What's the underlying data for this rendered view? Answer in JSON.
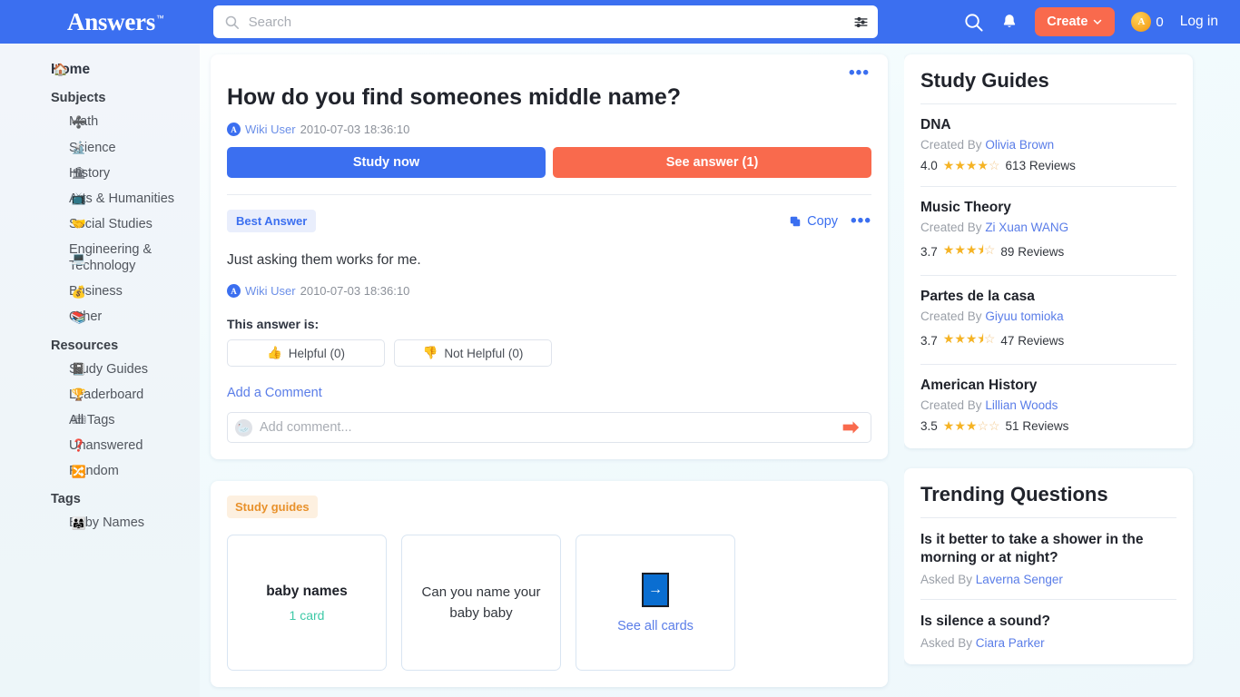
{
  "header": {
    "logo": "Answers",
    "logo_tm": "™",
    "search_placeholder": "Search",
    "search_value": "",
    "create_label": "Create",
    "coin_letter": "A",
    "coin_count": "0",
    "login_label": "Log in",
    "accent_blue": "#3B6FF0",
    "accent_orange": "#F96A4D"
  },
  "sidebar": {
    "home": {
      "label": "Home",
      "icon": "🏠"
    },
    "subjects_heading": "Subjects",
    "subjects": [
      {
        "label": "Math",
        "icon": "➗"
      },
      {
        "label": "Science",
        "icon": "🔬"
      },
      {
        "label": "History",
        "icon": "🏛"
      },
      {
        "label": "Arts & Humanities",
        "icon": "📺"
      },
      {
        "label": "Social Studies",
        "icon": "🤝"
      },
      {
        "label": "Engineering & Technology",
        "icon": "💻"
      },
      {
        "label": "Business",
        "icon": "💰"
      },
      {
        "label": "Other",
        "icon": "📚"
      }
    ],
    "resources_heading": "Resources",
    "resources": [
      {
        "label": "Study Guides",
        "icon": "📓"
      },
      {
        "label": "Leaderboard",
        "icon": "🏆"
      },
      {
        "label": "All Tags",
        "icon": "🎟"
      },
      {
        "label": "Unanswered",
        "icon": "❓"
      },
      {
        "label": "Random",
        "icon": "🔀"
      }
    ],
    "tags_heading": "Tags",
    "tags": [
      {
        "label": "Baby Names",
        "icon": "👨‍👩‍👧"
      }
    ]
  },
  "question": {
    "title": "How do you find someones middle name?",
    "author": "Wiki User",
    "timestamp": "2010-07-03 18:36:10",
    "avatar_letter": "A",
    "study_now_label": "Study now",
    "see_answer_label": "See answer (1)"
  },
  "answer": {
    "best_badge": "Best Answer",
    "copy_label": "Copy",
    "text": "Just asking them works for me.",
    "author": "Wiki User",
    "timestamp": "2010-07-03 18:36:10",
    "avatar_letter": "A",
    "vote_prompt": "This answer is:",
    "helpful_label": "Helpful (0)",
    "helpful_icon": "👍",
    "not_helpful_label": "Not Helpful (0)",
    "not_helpful_icon": "👎",
    "add_comment_link": "Add a Comment",
    "comment_placeholder": "Add comment...",
    "comment_value": ""
  },
  "study_guides_deck": {
    "badge": "Study guides",
    "cards": [
      {
        "type": "title",
        "title": "baby names",
        "subtitle": "1 card"
      },
      {
        "type": "question",
        "question": "Can you name your baby baby"
      },
      {
        "type": "more",
        "arrow": "→",
        "link": "See all cards"
      }
    ]
  },
  "rail": {
    "study_guides_title": "Study Guides",
    "guides": [
      {
        "name": "DNA",
        "created_by_label": "Created By",
        "author": "Olivia Brown",
        "rating": "4.0",
        "stars_full": 4,
        "stars_half": 0,
        "reviews": "613 Reviews"
      },
      {
        "name": "Music Theory",
        "created_by_label": "Created By",
        "author": "Zi Xuan WANG",
        "rating": "3.7",
        "stars_full": 3,
        "stars_half": 1,
        "reviews": "89 Reviews"
      },
      {
        "name": "Partes de la casa",
        "created_by_label": "Created By",
        "author": "Giyuu tomioka",
        "rating": "3.7",
        "stars_full": 3,
        "stars_half": 1,
        "reviews": "47 Reviews"
      },
      {
        "name": "American History",
        "created_by_label": "Created By",
        "author": "Lillian Woods",
        "rating": "3.5",
        "stars_full": 3,
        "stars_half": 0,
        "reviews": "51 Reviews"
      }
    ],
    "trending_title": "Trending Questions",
    "trending": [
      {
        "question": "Is it better to take a shower in the morning or at night?",
        "asked_by_label": "Asked By",
        "author": "Laverna Senger"
      },
      {
        "question": "Is silence a sound?",
        "asked_by_label": "Asked By",
        "author": "Ciara Parker"
      }
    ]
  }
}
